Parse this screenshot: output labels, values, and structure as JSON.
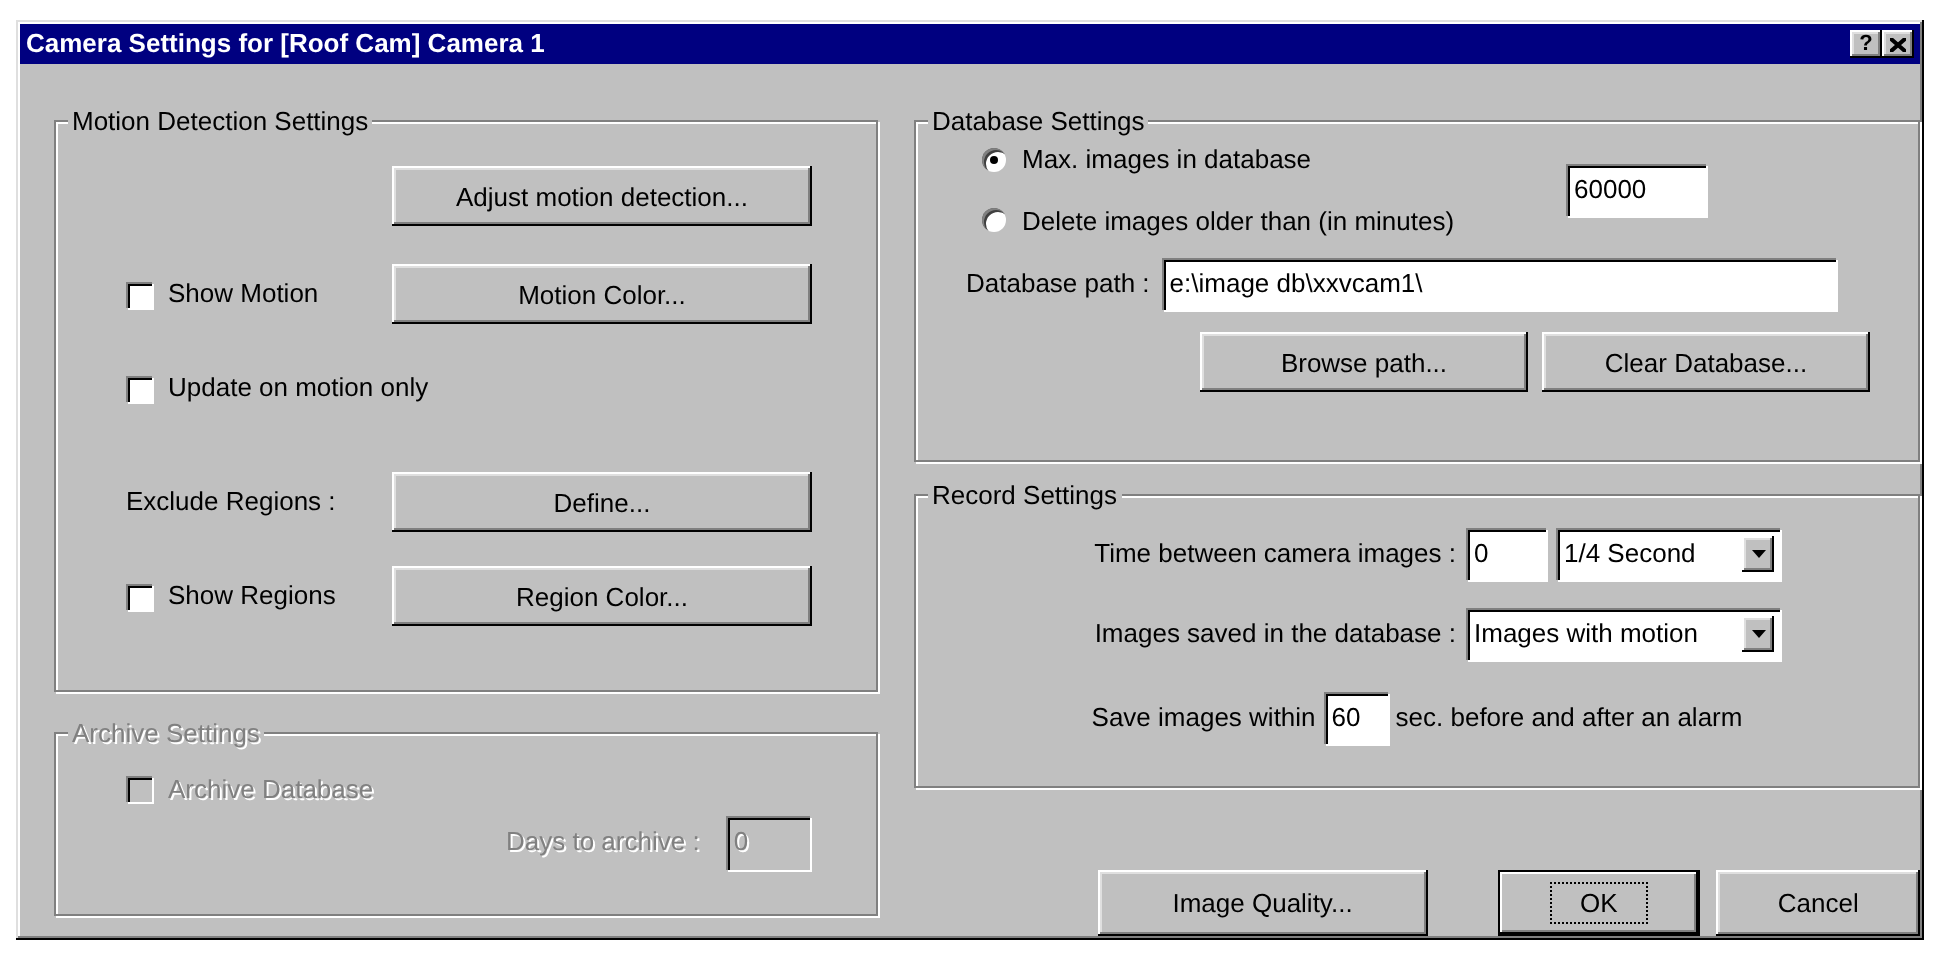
{
  "window": {
    "title": "Camera Settings for [Roof Cam] Camera 1",
    "help_button": "?"
  },
  "motion_detection": {
    "title": "Motion Detection Settings",
    "adjust_button": "Adjust motion detection...",
    "show_motion": {
      "label": "Show Motion",
      "checked": false
    },
    "motion_color_button": "Motion Color...",
    "update_on_motion_only": {
      "label": "Update on motion only",
      "checked": false
    },
    "exclude_regions_label": "Exclude Regions :",
    "define_button": "Define...",
    "show_regions": {
      "label": "Show Regions",
      "checked": false
    },
    "region_color_button": "Region Color..."
  },
  "archive": {
    "title": "Archive Settings",
    "disabled": true,
    "archive_database": {
      "label": "Archive Database",
      "checked": false
    },
    "days_label": "Days to archive :",
    "days_value": "0"
  },
  "database": {
    "title": "Database Settings",
    "options": [
      {
        "label": "Max. images in database",
        "selected": true
      },
      {
        "label": "Delete images older than (in minutes)",
        "selected": false
      }
    ],
    "limit_value": "60000",
    "path_label": "Database path :",
    "path_value": "e:\\image db\\xxvcam1\\",
    "browse_button": "Browse path...",
    "clear_button": "Clear Database..."
  },
  "record": {
    "title": "Record Settings",
    "time_label": "Time between camera images :",
    "time_value": "0",
    "time_unit": "1/4 Second",
    "images_label": "Images saved in the database :",
    "images_value": "Images with motion",
    "save_prefix": "Save images within",
    "save_value": "60",
    "save_suffix": "sec. before and after an alarm"
  },
  "buttons": [
    {
      "label": "Image Quality...",
      "default": false
    },
    {
      "label": "OK",
      "default": true
    },
    {
      "label": "Cancel",
      "default": false
    }
  ]
}
